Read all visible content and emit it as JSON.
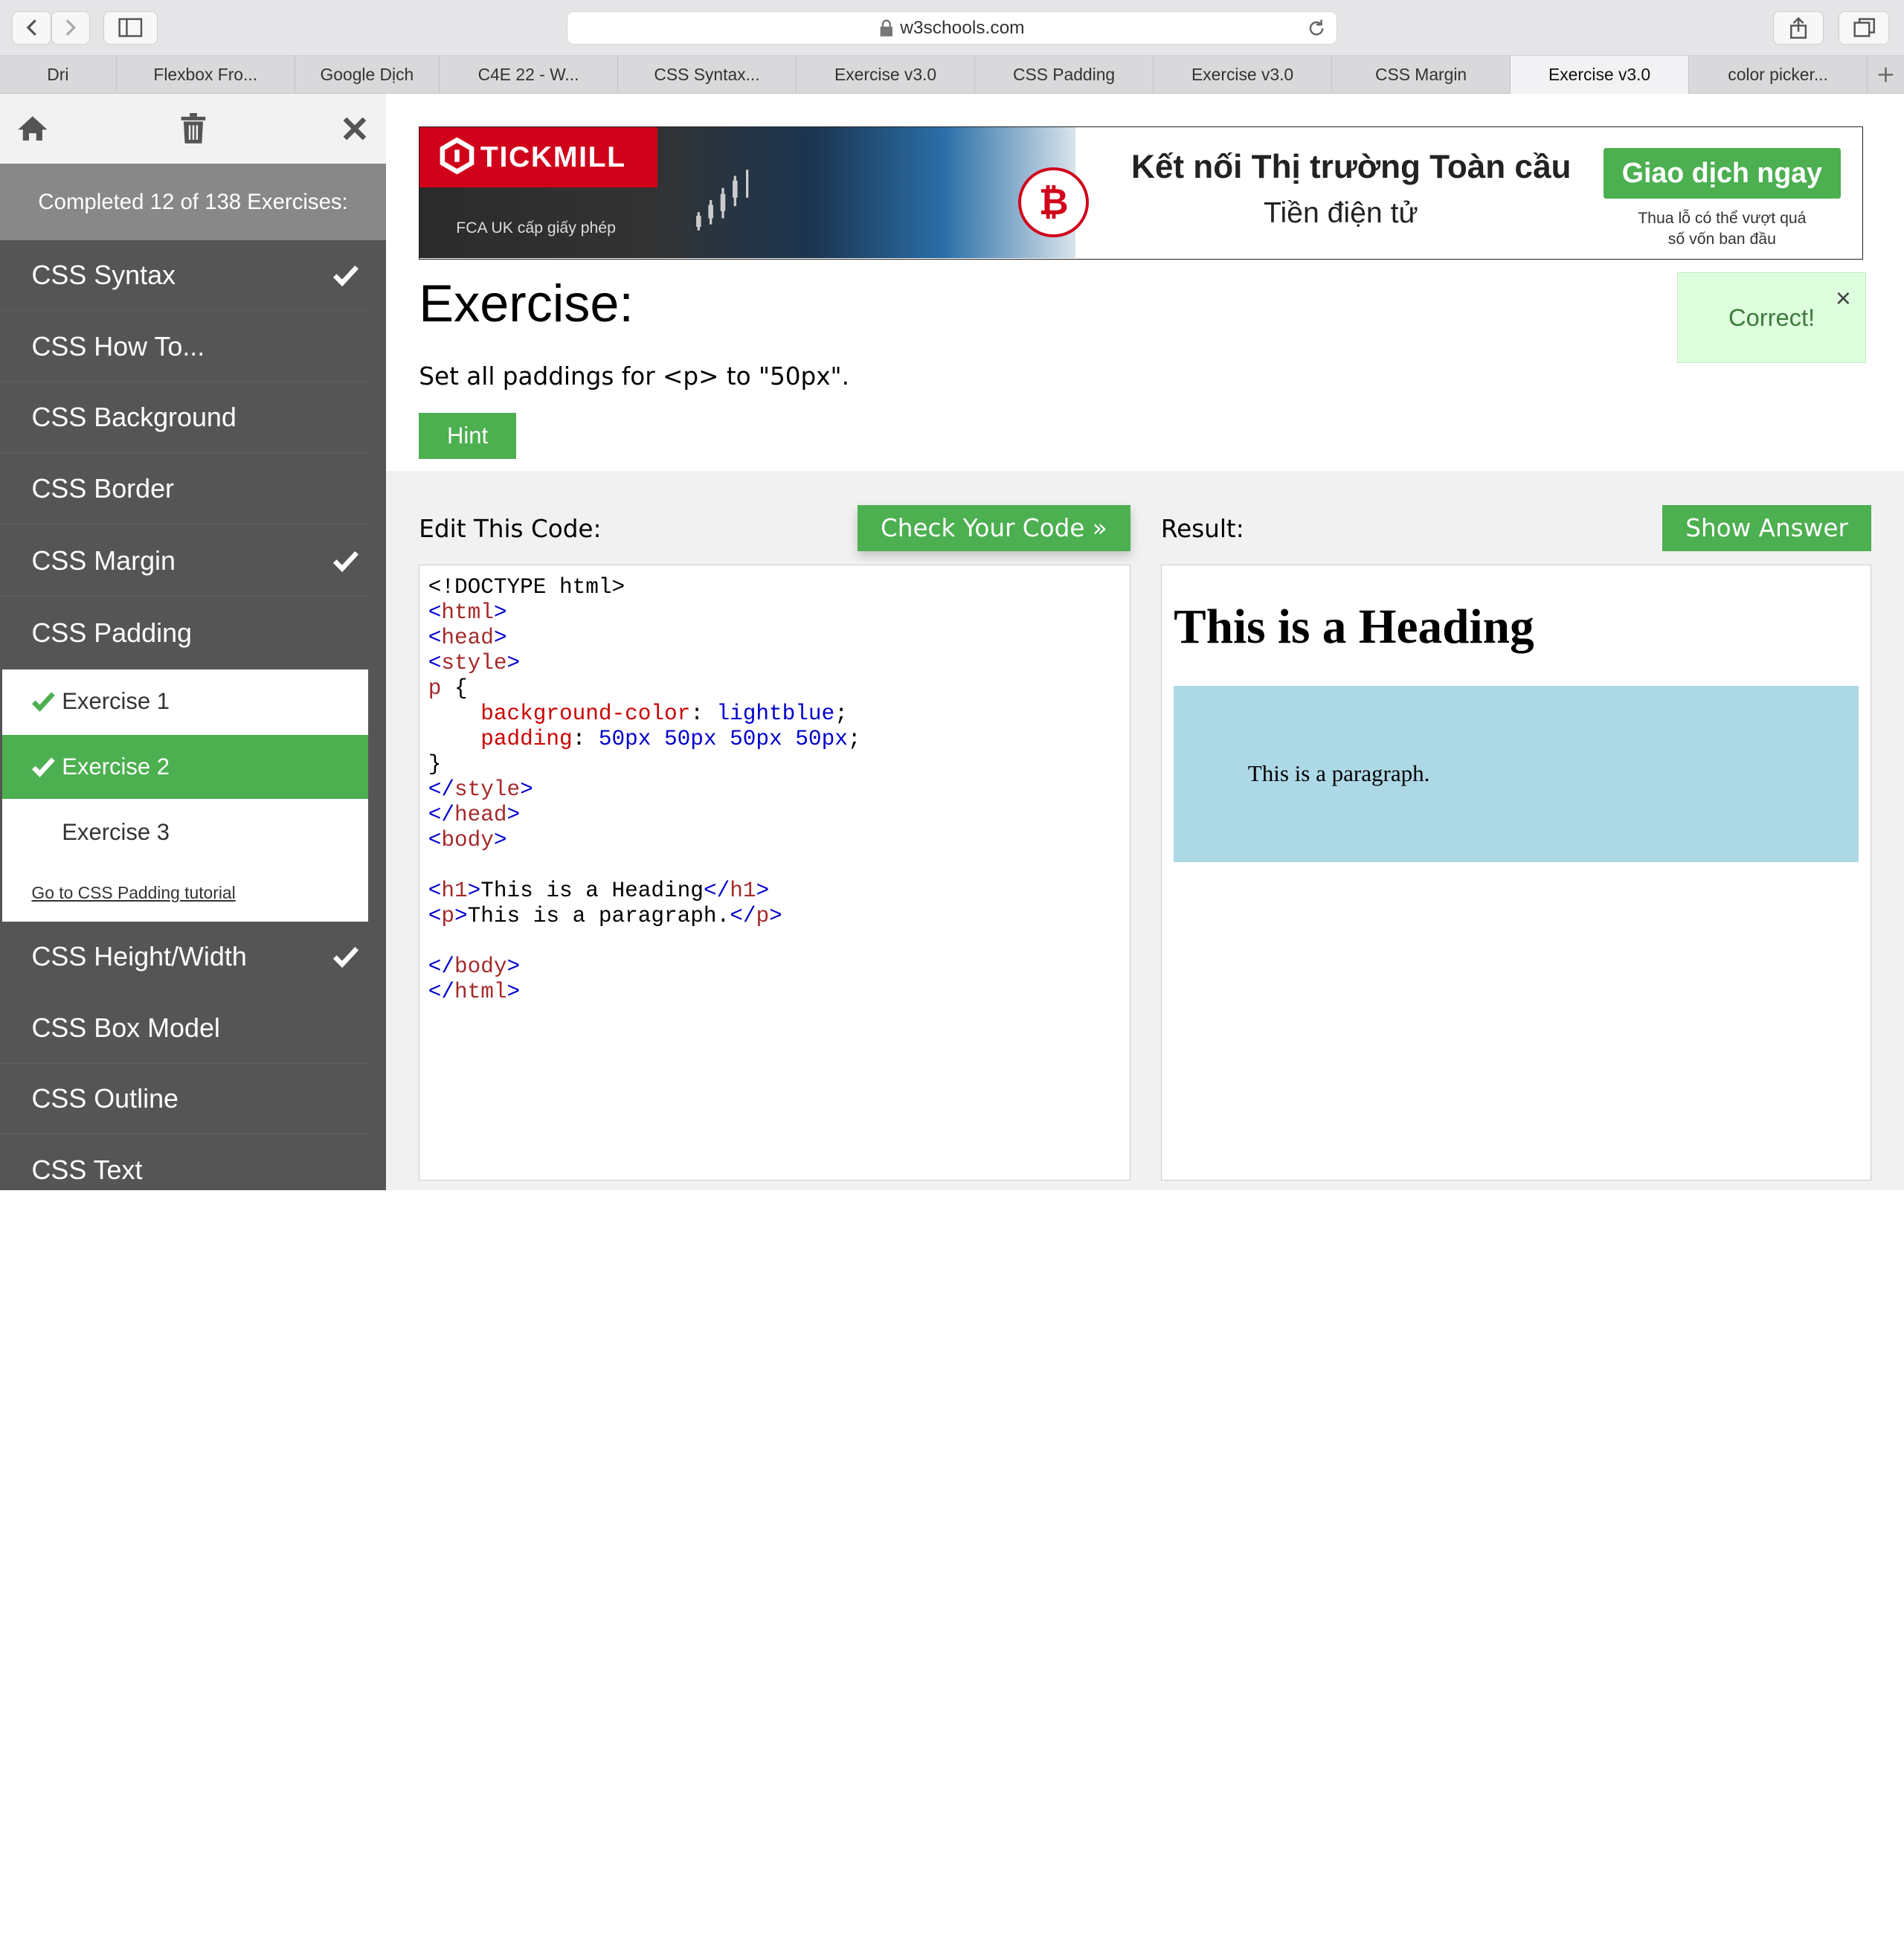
{
  "browser": {
    "url": "w3schools.com",
    "tabs": [
      "Dri",
      "Flexbox Fro...",
      "Google Dịch",
      "C4E 22 - W...",
      "CSS Syntax...",
      "Exercise v3.0",
      "CSS Padding",
      "Exercise v3.0",
      "CSS Margin",
      "Exercise v3.0",
      "color picker..."
    ],
    "active_tab_index": 9
  },
  "sidebar": {
    "completed": "Completed 12 of 138 Exercises:",
    "items": [
      {
        "label": "CSS Syntax",
        "done": true
      },
      {
        "label": "CSS How To...",
        "done": false
      },
      {
        "label": "CSS Background",
        "done": false
      },
      {
        "label": "CSS Border",
        "done": false
      },
      {
        "label": "CSS Margin",
        "done": true
      },
      {
        "label": "CSS Padding",
        "done": false
      }
    ],
    "sub_items": [
      {
        "label": "Exercise 1",
        "done": true
      },
      {
        "label": "Exercise 2",
        "done": true
      },
      {
        "label": "Exercise 3",
        "done": false
      }
    ],
    "tutorial_link": "Go to CSS Padding tutorial",
    "items_after": [
      {
        "label": "CSS Height/Width",
        "done": true
      },
      {
        "label": "CSS Box Model",
        "done": false
      },
      {
        "label": "CSS Outline",
        "done": false
      },
      {
        "label": "CSS Text",
        "done": false
      }
    ]
  },
  "ad": {
    "brand": "TICKMILL",
    "license": "FCA UK cấp giấy phép",
    "headline": "Kết nối Thị trường Toàn cầu",
    "subheadline": "Tiền điện tử",
    "cta": "Giao dịch ngay",
    "warning_line1": "Thua lỗ có thể vượt quá",
    "warning_line2": "số vốn ban đầu",
    "btc_symbol": "₿"
  },
  "exercise": {
    "title": "Exercise:",
    "description": "Set all paddings for <p> to \"50px\".",
    "hint_label": "Hint",
    "correct_text": "Correct!",
    "close_symbol": "×"
  },
  "editor": {
    "label": "Edit This Code:",
    "check_button": "Check Your Code »",
    "code": {
      "doctype": "<!DOCTYPE html>",
      "style_selector": "p",
      "prop1": "background-color",
      "val1": "lightblue",
      "prop2": "padding",
      "val2": "50px 50px 50px 50px",
      "h1_text": "This is a Heading",
      "p_text": "This is a paragraph."
    }
  },
  "result": {
    "label": "Result:",
    "show_answer": "Show Answer",
    "heading": "This is a Heading",
    "paragraph": "This is a paragraph."
  },
  "colors": {
    "green": "#4caf50",
    "sidebar": "#555555",
    "paragraph_bg": "#add8e6"
  }
}
